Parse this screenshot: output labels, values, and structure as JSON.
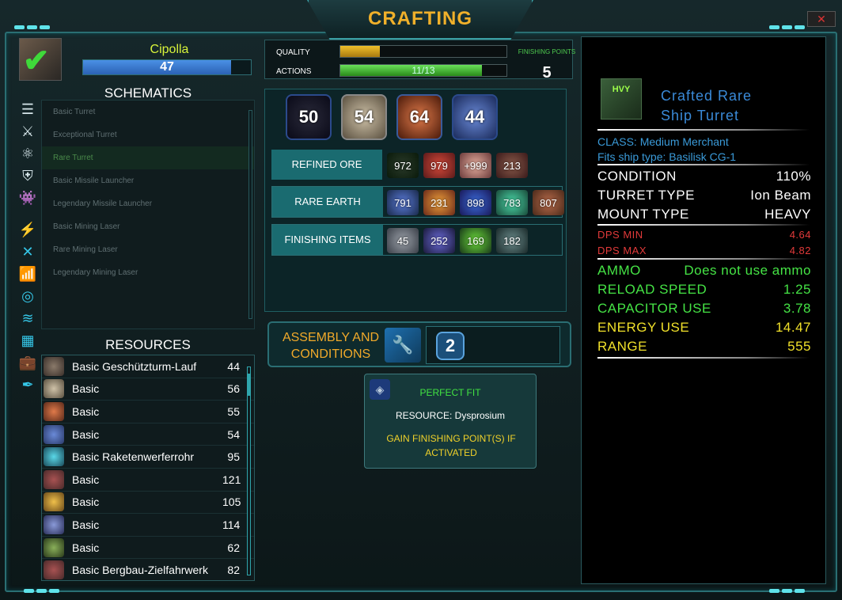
{
  "window": {
    "title": "CRAFTING"
  },
  "player": {
    "name": "Cipolla",
    "level": "47",
    "level_fraction": 0.88
  },
  "schematics": {
    "heading": "SCHEMATICS",
    "items": [
      {
        "label": "Basic Turret"
      },
      {
        "label": "Exceptional Turret"
      },
      {
        "label": "Rare Turret"
      },
      {
        "label": "Basic Missile Launcher"
      },
      {
        "label": "Legendary Missile Launcher"
      },
      {
        "label": "Basic Mining Laser"
      },
      {
        "label": "Rare Mining Laser"
      },
      {
        "label": "Legendary Mining Laser"
      }
    ],
    "active_index": 2
  },
  "resources": {
    "heading": "RESOURCES",
    "items": [
      {
        "name": "Basic Geschützturm-Lauf",
        "qty": "44"
      },
      {
        "name": "Basic",
        "qty": "56"
      },
      {
        "name": "Basic",
        "qty": "55"
      },
      {
        "name": "Basic",
        "qty": "54"
      },
      {
        "name": "Basic Raketenwerferrohr",
        "qty": "95"
      },
      {
        "name": "Basic",
        "qty": "121"
      },
      {
        "name": "Basic",
        "qty": "105"
      },
      {
        "name": "Basic",
        "qty": "114"
      },
      {
        "name": "Basic",
        "qty": "62"
      },
      {
        "name": "Basic Bergbau-Zielfahrwerk",
        "qty": "82"
      }
    ]
  },
  "quality": {
    "label": "QUALITY",
    "fraction": 0.24
  },
  "actions": {
    "label": "ACTIONS",
    "value": "11/13",
    "fraction": 0.85
  },
  "finishing_points": {
    "label": "FINISHING POINTS",
    "value": "5"
  },
  "top_slots": [
    "50",
    "54",
    "64",
    "44"
  ],
  "refined_ore": {
    "label": "REFINED ORE",
    "values": [
      "972",
      "979",
      "+999",
      "213"
    ]
  },
  "rare_earth": {
    "label": "RARE EARTH",
    "values": [
      "791",
      "231",
      "898",
      "783",
      "807"
    ]
  },
  "finishing_items": {
    "label": "FINISHING ITEMS",
    "values": [
      "45",
      "252",
      "169",
      "182"
    ]
  },
  "assembly": {
    "label_line1": "ASSEMBLY AND",
    "label_line2": "CONDITIONS",
    "slot_value": "2"
  },
  "tooltip": {
    "title": "PERFECT FIT",
    "resource": "RESOURCE: Dysprosium",
    "gain_line1": "GAIN FINISHING POINT(S) IF",
    "gain_line2": "ACTIVATED"
  },
  "item": {
    "icon_text": "HVY",
    "title_line1": "Crafted Rare",
    "title_line2": "Ship Turret",
    "class_line": "CLASS:  Medium Merchant",
    "fits_line": "Fits ship type: Basilisk CG-1",
    "stats_white": [
      {
        "k": "CONDITION",
        "v": "110%"
      },
      {
        "k": "TURRET TYPE",
        "v": "Ion Beam"
      },
      {
        "k": "MOUNT TYPE",
        "v": "HEAVY"
      }
    ],
    "stats_red": [
      {
        "k": "DPS MIN",
        "v": "4.64"
      },
      {
        "k": "DPS MAX",
        "v": "4.82"
      }
    ],
    "stats_green": [
      {
        "k": "AMMO",
        "v": "Does not use ammo"
      },
      {
        "k": "RELOAD SPEED",
        "v": "1.25"
      },
      {
        "k": "CAPACITOR USE",
        "v": "3.78"
      }
    ],
    "stats_yellow": [
      {
        "k": "ENERGY USE",
        "v": "14.47"
      },
      {
        "k": "RANGE",
        "v": "555"
      }
    ]
  },
  "colors": {
    "accent": "#f0b02a",
    "frame": "#2a6f73",
    "cyan_icon": "#35c7e8"
  }
}
